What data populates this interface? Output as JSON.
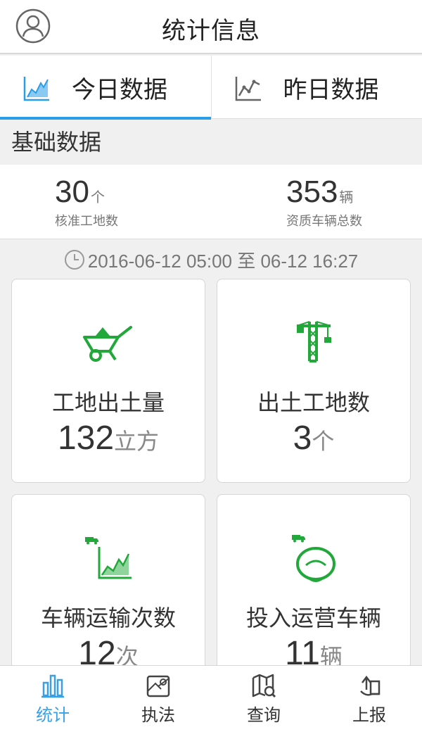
{
  "header": {
    "title": "统计信息"
  },
  "tabs": [
    {
      "label": "今日数据",
      "active": true
    },
    {
      "label": "昨日数据",
      "active": false
    }
  ],
  "section": {
    "title": "基础数据"
  },
  "basic_stats": [
    {
      "value": "30",
      "unit": "个",
      "label": "核准工地数"
    },
    {
      "value": "353",
      "unit": "辆",
      "label": "资质车辆总数"
    }
  ],
  "time_range": {
    "text": "2016-06-12 05:00 至 06-12 16:27"
  },
  "cards": [
    {
      "title": "工地出土量",
      "value": "132",
      "unit": "立方",
      "icon": "wheelbarrow-icon"
    },
    {
      "title": "出土工地数",
      "value": "3",
      "unit": "个",
      "icon": "tower-crane-icon"
    },
    {
      "title": "车辆运输次数",
      "value": "12",
      "unit": "次",
      "icon": "truck-chart-icon"
    },
    {
      "title": "投入运营车辆",
      "value": "11",
      "unit": "辆",
      "icon": "truck-steering-icon"
    }
  ],
  "bottom_nav": [
    {
      "label": "统计",
      "icon": "bar-chart-icon",
      "active": true
    },
    {
      "label": "执法",
      "icon": "map-icon",
      "active": false
    },
    {
      "label": "查询",
      "icon": "map-search-icon",
      "active": false
    },
    {
      "label": "上报",
      "icon": "report-icon",
      "active": false
    }
  ],
  "colors": {
    "accent": "#2a9de8",
    "icon_green": "#22a83a",
    "nav_active": "#3aa0e6"
  }
}
